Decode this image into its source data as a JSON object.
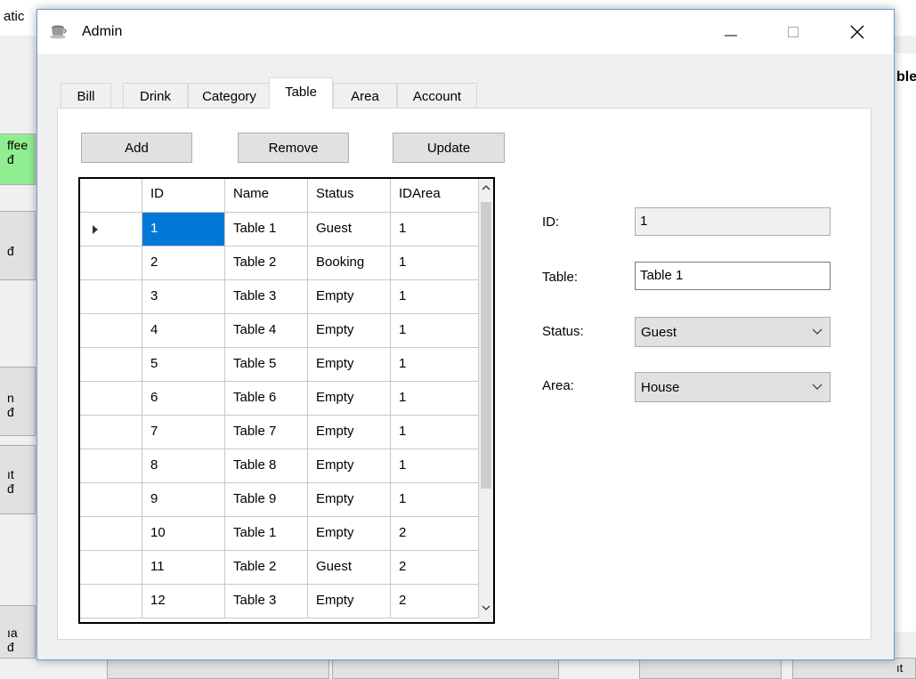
{
  "background_app": {
    "top_text": "atic",
    "right_label": "ble",
    "left_buttons": [
      {
        "line1": "ffee",
        "line2": "đ"
      },
      {
        "line1": "",
        "line2": "đ"
      },
      {
        "line1": "n",
        "line2": "đ"
      },
      {
        "line1": "ıt",
        "line2": "đ"
      },
      {
        "line1": "ıa",
        "line2": "đ"
      }
    ],
    "bottom_right_text": "ıt"
  },
  "window": {
    "title": "Admin",
    "icons": {
      "app": "coffee-cup-icon",
      "minimize": "minimize-icon",
      "maximize": "maximize-icon",
      "close": "close-icon"
    }
  },
  "tabs": [
    {
      "label": "Bill"
    },
    {
      "label": "Drink"
    },
    {
      "label": "Category"
    },
    {
      "label": "Table"
    },
    {
      "label": "Area"
    },
    {
      "label": "Account"
    }
  ],
  "active_tab": "Table",
  "toolbar": {
    "add_label": "Add",
    "remove_label": "Remove",
    "update_label": "Update"
  },
  "grid": {
    "columns": [
      "",
      "ID",
      "Name",
      "Status",
      "IDArea"
    ],
    "rows": [
      {
        "id": "1",
        "name": "Table 1",
        "status": "Guest",
        "idarea": "1"
      },
      {
        "id": "2",
        "name": "Table 2",
        "status": "Booking",
        "idarea": "1"
      },
      {
        "id": "3",
        "name": "Table 3",
        "status": "Empty",
        "idarea": "1"
      },
      {
        "id": "4",
        "name": "Table 4",
        "status": "Empty",
        "idarea": "1"
      },
      {
        "id": "5",
        "name": "Table 5",
        "status": "Empty",
        "idarea": "1"
      },
      {
        "id": "6",
        "name": "Table 6",
        "status": "Empty",
        "idarea": "1"
      },
      {
        "id": "7",
        "name": "Table 7",
        "status": "Empty",
        "idarea": "1"
      },
      {
        "id": "8",
        "name": "Table 8",
        "status": "Empty",
        "idarea": "1"
      },
      {
        "id": "9",
        "name": "Table 9",
        "status": "Empty",
        "idarea": "1"
      },
      {
        "id": "10",
        "name": "Table 1",
        "status": "Empty",
        "idarea": "2"
      },
      {
        "id": "11",
        "name": "Table 2",
        "status": "Guest",
        "idarea": "2"
      },
      {
        "id": "12",
        "name": "Table 3",
        "status": "Empty",
        "idarea": "2"
      }
    ],
    "selected_row": 0
  },
  "form": {
    "id_label": "ID:",
    "id_value": "1",
    "table_label": "Table:",
    "table_value": "Table 1",
    "status_label": "Status:",
    "status_value": "Guest",
    "area_label": "Area:",
    "area_value": "House"
  }
}
